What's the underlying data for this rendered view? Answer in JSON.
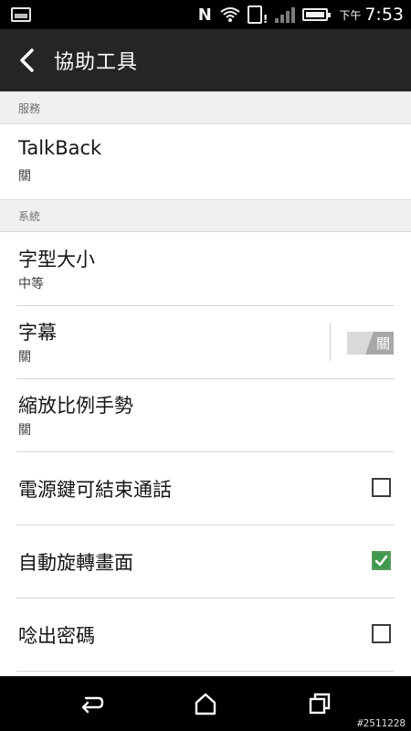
{
  "statusbar": {
    "nfc_letter": "N",
    "ampm": "下午",
    "time": "7:53"
  },
  "actionbar": {
    "title": "協助工具"
  },
  "sections": {
    "services": "服務",
    "system": "系統"
  },
  "items": {
    "talkback": {
      "title": "TalkBack",
      "subtitle": "關"
    },
    "font_size": {
      "title": "字型大小",
      "subtitle": "中等"
    },
    "captions": {
      "title": "字幕",
      "subtitle": "關",
      "toggle_label": "關",
      "toggle_on": false
    },
    "magnification": {
      "title": "縮放比例手勢",
      "subtitle": "關"
    },
    "power_ends_call": {
      "title": "電源鍵可結束通話",
      "checked": false
    },
    "auto_rotate": {
      "title": "自動旋轉畫面",
      "checked": true
    },
    "speak_passwords": {
      "title": "唸出密碼",
      "checked": false
    }
  },
  "navbar": {
    "watermark": "#2511228"
  },
  "colors": {
    "actionbar": "#252525",
    "checkbox_checked": "#3f9a4d",
    "section_bg": "#f0f0f0"
  }
}
